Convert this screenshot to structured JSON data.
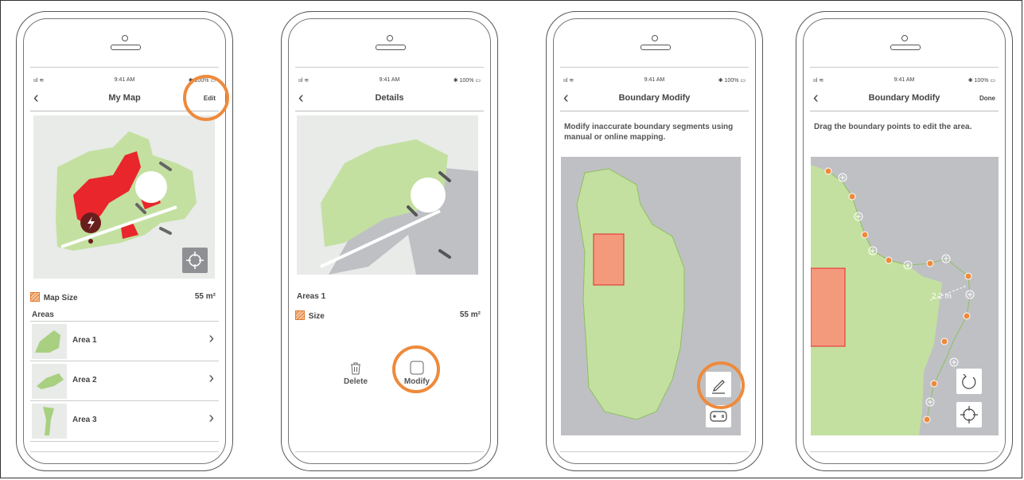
{
  "status": {
    "signal": "ııl ≋",
    "time": "9:41 AM",
    "battery": "✱ 100% ▭"
  },
  "screen1": {
    "back": "‹",
    "title": "My Map",
    "right": "Edit",
    "map_size_label": "Map Size",
    "map_size_value": "55 m²",
    "areas_heading": "Areas",
    "areas": [
      {
        "label": "Area 1",
        "chev": "›"
      },
      {
        "label": "Area 2",
        "chev": "›"
      },
      {
        "label": "Area 3",
        "chev": "›"
      }
    ]
  },
  "screen2": {
    "back": "‹",
    "title": "Details",
    "area_name": "Areas 1",
    "size_label": "Size",
    "size_value": "55 m²",
    "delete_label": "Delete",
    "modify_label": "Modify"
  },
  "screen3": {
    "back": "‹",
    "title": "Boundary Modify",
    "description": "Modify inaccurate boundary segments using manual or online mapping."
  },
  "screen4": {
    "back": "‹",
    "title": "Boundary Modify",
    "right": "Done",
    "description": "Drag the boundary points to edit the area.",
    "distance": "2.2 m"
  },
  "colors": {
    "accent_orange": "#ee8a3c",
    "lawn_green": "#c3e0a0",
    "obstacle_red": "#e8262b",
    "zone_salmon": "#f49a7c",
    "map_gray": "#bfc0c4"
  }
}
